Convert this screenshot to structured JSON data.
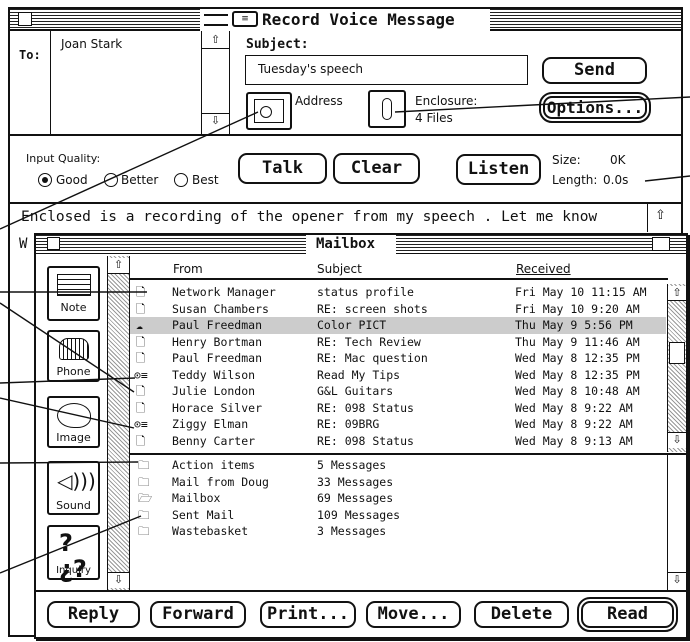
{
  "record_window": {
    "title": "Record Voice Message",
    "to_label": "To:",
    "to_value": "Joan Stark",
    "subject_label": "Subject:",
    "subject_value": "Tuesday's speech",
    "send_label": "Send",
    "address_label": "Address",
    "enclosure_label": "Enclosure:",
    "enclosure_value": "4 Files",
    "options_label": "Options...",
    "input_quality_label": "Input Quality:",
    "quality_options": [
      "Good",
      "Better",
      "Best"
    ],
    "quality_selected": "Good",
    "talk_label": "Talk",
    "clear_label": "Clear",
    "listen_label": "Listen",
    "size_label": "Size:",
    "size_value": "0K",
    "length_label": "Length:",
    "length_value": "0.0s",
    "body_line1": "Enclosed is a recording of the opener from my speech . Let me know",
    "body_line2_start": "W"
  },
  "mailbox_window": {
    "title": "Mailbox",
    "sidebar": [
      {
        "label": "Note",
        "icon": "note-icon"
      },
      {
        "label": "Phone",
        "icon": "phone-icon"
      },
      {
        "label": "Image",
        "icon": "image-icon"
      },
      {
        "label": "Sound",
        "icon": "sound-icon"
      },
      {
        "label": "Inquiry",
        "icon": "inquiry-icon"
      }
    ],
    "columns": {
      "from": "From",
      "subject": "Subject",
      "received": "Received"
    },
    "messages": [
      {
        "from": "Network Manager",
        "subject": "status profile",
        "received": "Fri  May 10 11:15 AM"
      },
      {
        "from": "Susan Chambers",
        "subject": "RE: screen shots",
        "received": "Fri  May 10  9:20 AM"
      },
      {
        "from": "Paul Freedman",
        "subject": "Color PICT",
        "received": "Thu May  9  5:56 PM"
      },
      {
        "from": "Henry Bortman",
        "subject": "RE: Tech Review",
        "received": "Thu May  9 11:46 AM"
      },
      {
        "from": "Paul Freedman",
        "subject": "RE: Mac question",
        "received": "Wed May  8 12:35 PM"
      },
      {
        "from": "Teddy Wilson",
        "subject": "Read My Tips",
        "received": "Wed May  8 12:35 PM"
      },
      {
        "from": "Julie London",
        "subject": "G&L Guitars",
        "received": "Wed May  8 10:48 AM"
      },
      {
        "from": "Horace Silver",
        "subject": "RE: 098 Status",
        "received": "Wed May  8  9:22 AM"
      },
      {
        "from": "Ziggy Elman",
        "subject": "RE: 09BRG",
        "received": "Wed May  8  9:22 AM"
      },
      {
        "from": "Benny Carter",
        "subject": "RE: 098 Status",
        "received": "Wed May  8  9:13 AM"
      }
    ],
    "folders": [
      {
        "name": "Action items",
        "count": "5 Messages"
      },
      {
        "name": "Mail from Doug",
        "count": "33 Messages"
      },
      {
        "name": "Mailbox",
        "count": "69 Messages"
      },
      {
        "name": "Sent Mail",
        "count": "109 Messages"
      },
      {
        "name": "Wastebasket",
        "count": "3 Messages"
      }
    ],
    "buttons": {
      "reply": "Reply",
      "forward": "Forward",
      "print": "Print...",
      "move": "Move...",
      "delete": "Delete",
      "read": "Read"
    }
  }
}
